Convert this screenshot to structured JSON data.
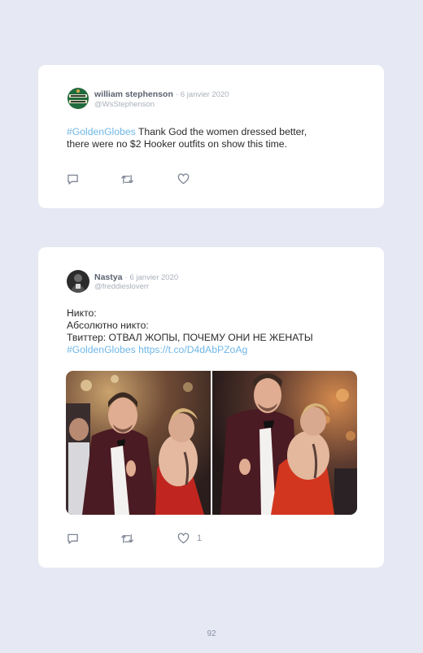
{
  "tweets": [
    {
      "author_name": "william stephenson",
      "separator": "·",
      "date": "6 janvier 2020",
      "handle": "@WsStephenson",
      "text_lines": [
        {
          "hashtag": "#GoldenGlobes",
          "rest": " Thank God the women dressed better,"
        },
        {
          "plain": "there were no $2 Hooker outfits on show this time."
        }
      ],
      "actions": {
        "reply_icon": "reply-icon",
        "retweet_icon": "retweet-icon",
        "like_icon": "heart-icon"
      }
    },
    {
      "author_name": "Nastya",
      "separator": "·",
      "date": "6 janvier 2020",
      "handle": "@freddiesloverr",
      "text_lines": [
        "Никто:",
        "Абсолютно никто:",
        "Твиттер: ОТВАЛ ЖОПЫ, ПОЧЕМУ ОНИ НЕ ЖЕНАТЫ"
      ],
      "hashtag": "#GoldenGlobes",
      "link": "https://t.co/D4dAbPZoAg",
      "like_count": "1",
      "media_count": 2,
      "actions": {
        "reply_icon": "reply-icon",
        "retweet_icon": "retweet-icon",
        "like_icon": "heart-icon"
      }
    }
  ],
  "page_number": "92",
  "colors": {
    "page_background": "#e6e8f3",
    "card_background": "#ffffff",
    "link": "#6fb7e8",
    "muted": "#aab0bb",
    "name": "#5b6270"
  }
}
